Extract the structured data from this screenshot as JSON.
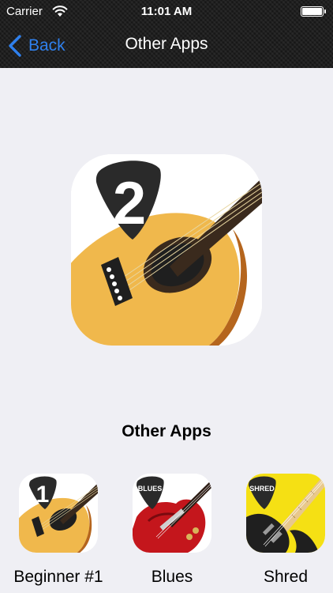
{
  "status_bar": {
    "carrier": "Carrier",
    "time": "11:01 AM",
    "wifi_icon": "wifi-icon",
    "battery_icon": "battery-icon"
  },
  "nav": {
    "back_label": "Back",
    "back_icon": "chevron-left-icon",
    "title": "Other Apps"
  },
  "hero": {
    "icon": "guitar-app-icon",
    "badge_number": "2"
  },
  "section": {
    "title": "Other Apps"
  },
  "apps": [
    {
      "name": "Beginner #1",
      "badge": "1",
      "icon": "acoustic-guitar-app-icon"
    },
    {
      "name": "Blues",
      "badge": "BLUES",
      "icon": "blues-guitar-app-icon"
    },
    {
      "name": "Shred",
      "badge": "SHRED",
      "icon": "shred-guitar-app-icon"
    }
  ],
  "colors": {
    "nav_background": "#1f1f1f",
    "page_background": "#efeff4",
    "accent": "#2f80ed",
    "guitar_body": "#f0b84c",
    "blues_red": "#c4161c",
    "shred_yellow": "#f5e014"
  }
}
